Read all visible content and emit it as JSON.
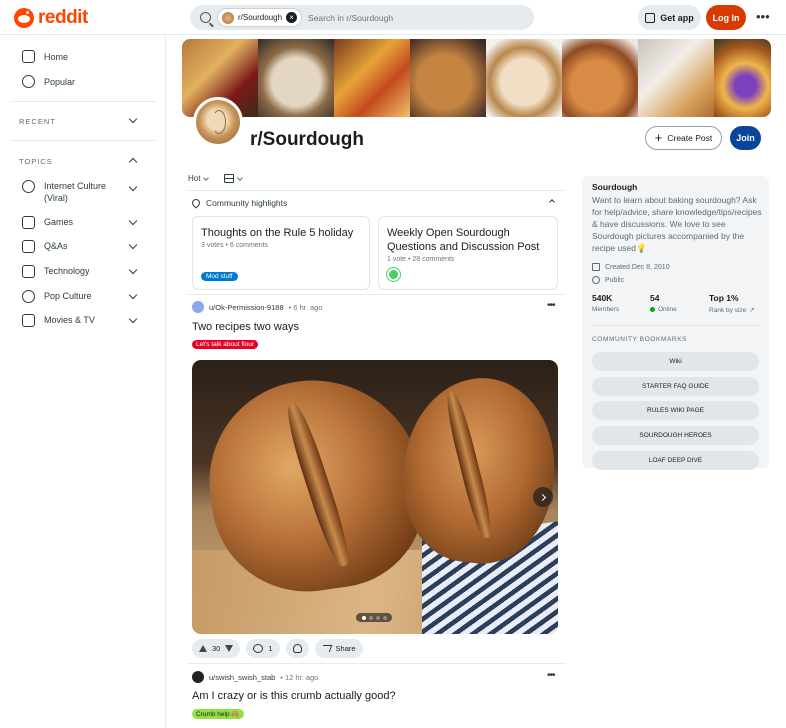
{
  "header": {
    "logo_text": "reddit",
    "search_chip": "r/Sourdough",
    "search_placeholder": "Search in r/Sourdough",
    "get_app": "Get app",
    "login": "Log In",
    "more": "•••"
  },
  "sidebar": {
    "nav": [
      {
        "label": "Home",
        "icon": "home-icon"
      },
      {
        "label": "Popular",
        "icon": "popular-icon"
      }
    ],
    "recent_label": "RECENT",
    "topics_label": "TOPICS",
    "topics": [
      {
        "label": "Internet Culture (Viral)",
        "icon": "internet-culture-icon"
      },
      {
        "label": "Games",
        "icon": "games-icon"
      },
      {
        "label": "Q&As",
        "icon": "qa-icon"
      },
      {
        "label": "Technology",
        "icon": "technology-icon"
      },
      {
        "label": "Pop Culture",
        "icon": "pop-culture-icon"
      },
      {
        "label": "Movies & TV",
        "icon": "movies-tv-icon"
      }
    ]
  },
  "community": {
    "name": "r/Sourdough",
    "create_post": "Create Post",
    "join": "Join"
  },
  "feed": {
    "sort": "Hot",
    "highlights_label": "Community highlights",
    "highlights": [
      {
        "title": "Thoughts on the Rule 5 holiday",
        "meta": "3 votes • 6 comments",
        "flair": "Mod stuff"
      },
      {
        "title": "Weekly Open Sourdough Questions and Discussion Post",
        "meta": "1 vote • 28 comments"
      }
    ],
    "posts": [
      {
        "user": "u/Ok-Permission-9188",
        "time": "• 6 hr. ago",
        "title": "Two recipes two ways",
        "flair": "Let's talk about flour",
        "votes": "30",
        "comments": "1",
        "share": "Share"
      },
      {
        "user": "u/swish_swish_stab",
        "time": "• 12 hr. ago",
        "title": "Am I crazy or is this crumb actually good?",
        "flair": "Crumb help 🙈"
      }
    ]
  },
  "about": {
    "name": "Sourdough",
    "description": "Want to learn about baking sourdough? Ask for help/advice, share knowledge/tips/recipes & have discussions. We love to see Sourdough pictures accompanied by the recipe used💡",
    "created": "Created Dec 8, 2010",
    "visibility": "Public",
    "stats": [
      {
        "value": "540K",
        "label": "Members"
      },
      {
        "value": "54",
        "label": "Online"
      },
      {
        "value": "Top 1%",
        "label": "Rank by size"
      }
    ],
    "bookmarks_label": "COMMUNITY BOOKMARKS",
    "bookmarks": [
      "Wiki",
      "STARTER FAQ GUIDE",
      "RULES WIKI PAGE",
      "SOURDOUGH HEROES",
      "LOAF DEEP DIVE"
    ]
  },
  "colors": {
    "brand": "#ff4500",
    "login_button": "#d93a00",
    "join_button": "#0a449b",
    "flair_red": "#ea0027",
    "flair_blue": "#0079d3"
  }
}
